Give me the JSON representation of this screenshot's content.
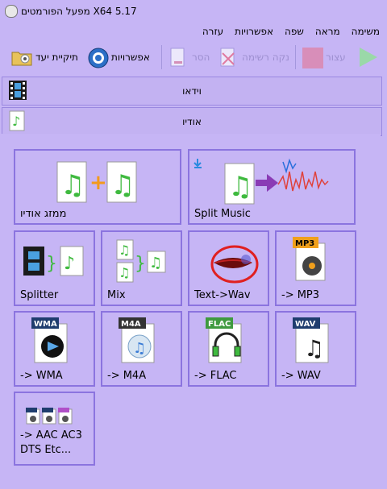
{
  "window": {
    "title": "X64 5.17 מפעל הפורמטים"
  },
  "menu": [
    "משימה",
    "מראה",
    "שפה",
    "אפשרויות",
    "עזרה"
  ],
  "toolbar": {
    "target_folder": "תיקיית יעד",
    "options": "אפשרויות",
    "remove": "הסר",
    "clear_list": "נקה רשימה",
    "stop": "עצור"
  },
  "sections": {
    "video": "וידאו",
    "audio": "אודיו"
  },
  "tiles": [
    {
      "id": "audio-joiner",
      "label": "ממזג אודיו"
    },
    {
      "id": "split-music",
      "label": "Split Music"
    },
    {
      "id": "splitter",
      "label": "Splitter"
    },
    {
      "id": "mix",
      "label": "Mix"
    },
    {
      "id": "text-to-wav",
      "label": "Text->Wav"
    },
    {
      "id": "to-mp3",
      "label": "-> MP3"
    },
    {
      "id": "to-wma",
      "label": "-> WMA"
    },
    {
      "id": "to-m4a",
      "label": "-> M4A"
    },
    {
      "id": "to-flac",
      "label": "-> FLAC"
    },
    {
      "id": "to-wav",
      "label": "-> WAV"
    },
    {
      "id": "to-aac-line1",
      "label": "-> AAC AC3"
    },
    {
      "id": "to-aac-line2",
      "label": "DTS Etc..."
    }
  ],
  "badges": {
    "mp3": "MP3",
    "wma": "WMA",
    "m4a": "M4A",
    "flac": "FLAC",
    "wav": "WAV"
  },
  "colors": {
    "background": "#c6b5f5",
    "tile_border": "#8b74df",
    "note_green": "#3fba3f"
  }
}
